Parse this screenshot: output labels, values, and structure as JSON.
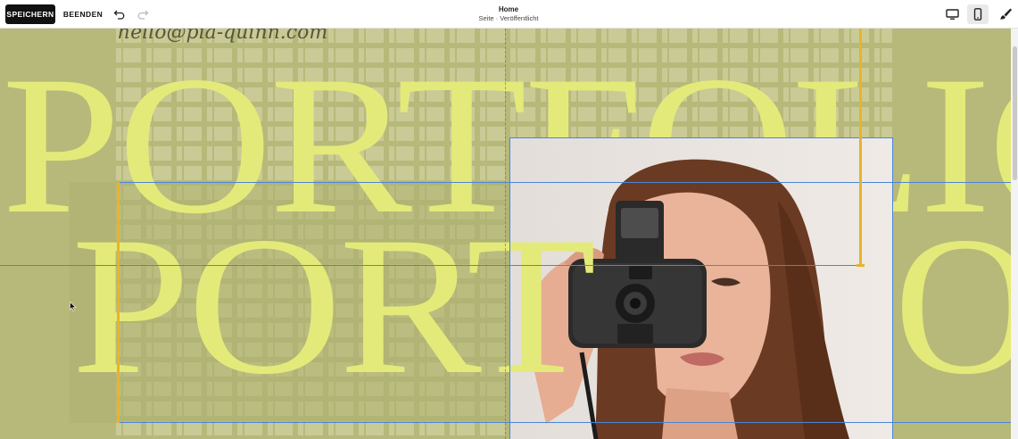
{
  "toolbar": {
    "save_label": "SPEICHERN",
    "exit_label": "BEENDEN",
    "undo_icon": "undo-icon",
    "redo_icon": "redo-icon",
    "page_title": "Home",
    "page_status": "Seite · Veröffentlicht",
    "device_desktop_icon": "desktop-icon",
    "device_mobile_icon": "mobile-icon",
    "design_icon": "brush-icon"
  },
  "canvas": {
    "email": "hello@pia-quinn.com",
    "headline_top": "PORTFOLIO",
    "headline_bottom_left": "PORT",
    "headline_bottom_right": "O",
    "background_color": "#b7b97a",
    "headline_color": "#e4ea7a"
  },
  "colors": {
    "selection": "#4a86d6",
    "guide": "#e8b32b",
    "save_button": "#111111"
  }
}
